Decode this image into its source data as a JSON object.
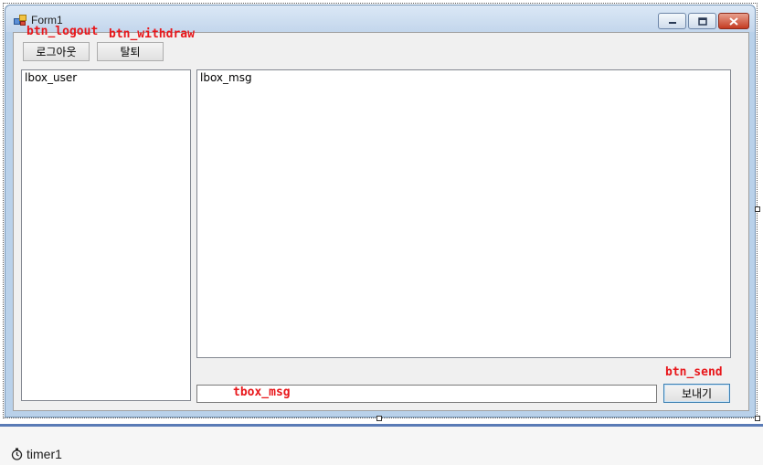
{
  "window": {
    "title": "Form1",
    "icon": "form-app-icon"
  },
  "buttons": {
    "logout_label": "로그아웃",
    "withdraw_label": "탈퇴",
    "send_label": "보내기"
  },
  "listboxes": {
    "user_name": "lbox_user",
    "msg_name": "lbox_msg"
  },
  "annotations": {
    "btn_logout": "btn_logout",
    "btn_withdraw": "btn_withdraw",
    "btn_send": "btn_send",
    "tbox_msg": "tbox_msg"
  },
  "tray": {
    "timer_name": "timer1",
    "timer_icon": "stopwatch-icon"
  },
  "colors": {
    "annotation": "#e8161a",
    "form_border": "#b9d1ea",
    "client_bg": "#f0f0f0"
  }
}
